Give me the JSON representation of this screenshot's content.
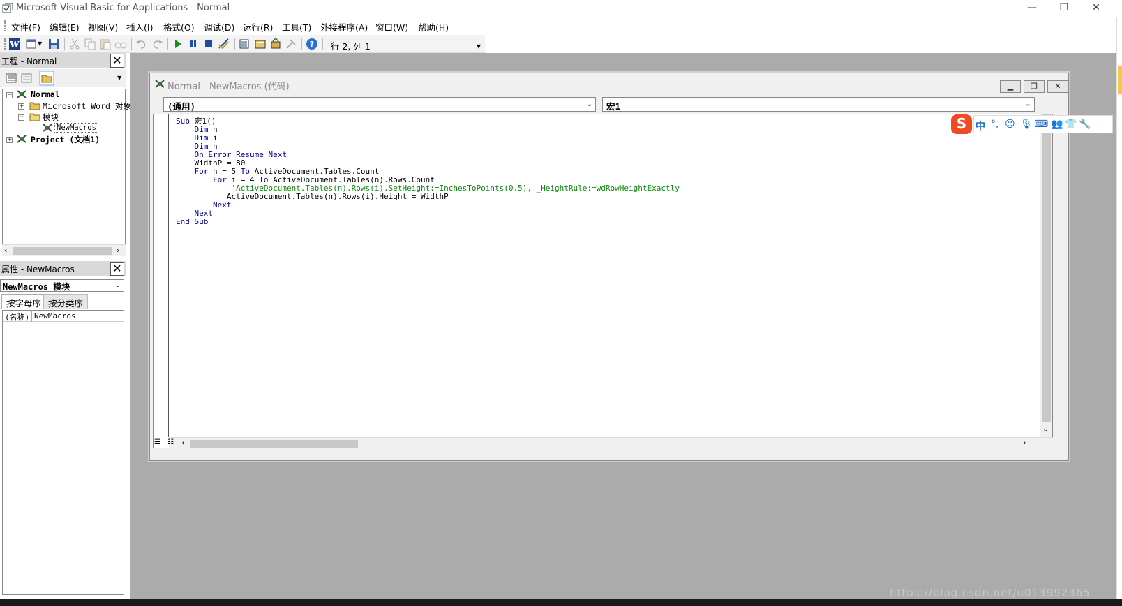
{
  "window": {
    "title": "Microsoft Visual Basic for Applications - Normal",
    "minimize": "—",
    "restore": "❐",
    "close": "✕"
  },
  "menu": [
    {
      "label": "文件(F)"
    },
    {
      "label": "编辑(E)"
    },
    {
      "label": "视图(V)"
    },
    {
      "label": "插入(I)"
    },
    {
      "label": "格式(O)"
    },
    {
      "label": "调试(D)"
    },
    {
      "label": "运行(R)"
    },
    {
      "label": "工具(T)"
    },
    {
      "label": "外接程序(A)"
    },
    {
      "label": "窗口(W)"
    },
    {
      "label": "帮助(H)"
    }
  ],
  "toolbar": {
    "cursor_position": "行 2, 列 1"
  },
  "project_pane": {
    "title": "工程 - Normal",
    "tree": {
      "normal": "Normal",
      "word_objects": "Microsoft Word 对象",
      "modules": "模块",
      "newmacros": "NewMacros",
      "project": "Project (文档1)"
    }
  },
  "properties_pane": {
    "title": "属性 - NewMacros",
    "object_combo": "NewMacros 模块",
    "tabs": [
      "按字母序",
      "按分类序"
    ],
    "rows": [
      {
        "name": "(名称)",
        "value": "NewMacros"
      }
    ]
  },
  "code_window": {
    "title": "Normal - NewMacros (代码)",
    "object_combo": "(通用)",
    "proc_combo": "宏1",
    "lines": [
      [
        {
          "t": "Sub ",
          "c": "kw"
        },
        {
          "t": "宏1()",
          "c": ""
        }
      ],
      [
        {
          "t": "    Dim ",
          "c": "kw"
        },
        {
          "t": "h",
          "c": ""
        }
      ],
      [
        {
          "t": "    Dim ",
          "c": "kw"
        },
        {
          "t": "i",
          "c": ""
        }
      ],
      [
        {
          "t": "    Dim ",
          "c": "kw"
        },
        {
          "t": "n",
          "c": ""
        }
      ],
      [
        {
          "t": "    On Error Resume Next",
          "c": "kw"
        }
      ],
      [
        {
          "t": "    WidthP = 80",
          "c": ""
        }
      ],
      [
        {
          "t": "    For ",
          "c": "kw"
        },
        {
          "t": "n = 5 ",
          "c": ""
        },
        {
          "t": "To ",
          "c": "kw"
        },
        {
          "t": "ActiveDocument.Tables.Count",
          "c": ""
        }
      ],
      [
        {
          "t": "        For ",
          "c": "kw"
        },
        {
          "t": "i = 4 ",
          "c": ""
        },
        {
          "t": "To ",
          "c": "kw"
        },
        {
          "t": "ActiveDocument.Tables(n).Rows.Count",
          "c": ""
        }
      ],
      [
        {
          "t": "            'ActiveDocument.Tables(n).Rows(i).SetHeight:=InchesToPoints(0.5), _HeightRule:=wdRowHeightExactly",
          "c": "cm"
        }
      ],
      [
        {
          "t": "           ActiveDocument.Tables(n).Rows(i).Height = WidthP",
          "c": ""
        }
      ],
      [
        {
          "t": "        Next",
          "c": "kw"
        }
      ],
      [
        {
          "t": "    Next",
          "c": "kw"
        }
      ],
      [
        {
          "t": "End Sub",
          "c": "kw"
        }
      ]
    ]
  },
  "ime_bar": {
    "brand": "S",
    "mode": "中"
  },
  "watermark": "https://blog.csdn.net/u013992365"
}
